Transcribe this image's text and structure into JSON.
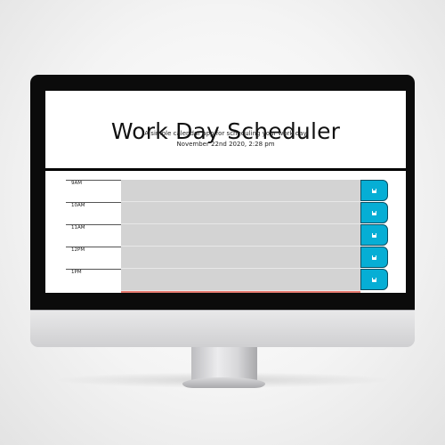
{
  "header": {
    "title": "Work Day Scheduler",
    "subtitle": "A simple calendar app for scheduling your work day",
    "current_day": "November 22nd 2020, 2:28 pm"
  },
  "time_blocks": [
    {
      "hour": "9AM",
      "text": ""
    },
    {
      "hour": "10AM",
      "text": ""
    },
    {
      "hour": "11AM",
      "text": ""
    },
    {
      "hour": "12PM",
      "text": ""
    },
    {
      "hour": "1PM",
      "text": ""
    }
  ],
  "colors": {
    "past_block": "#d3d3d3",
    "present_block": "#e87c72",
    "save_button": "#06aed5",
    "monitor_bezel": "#0b0b0b"
  },
  "icons": {
    "save_button_icon": "save-icon"
  }
}
